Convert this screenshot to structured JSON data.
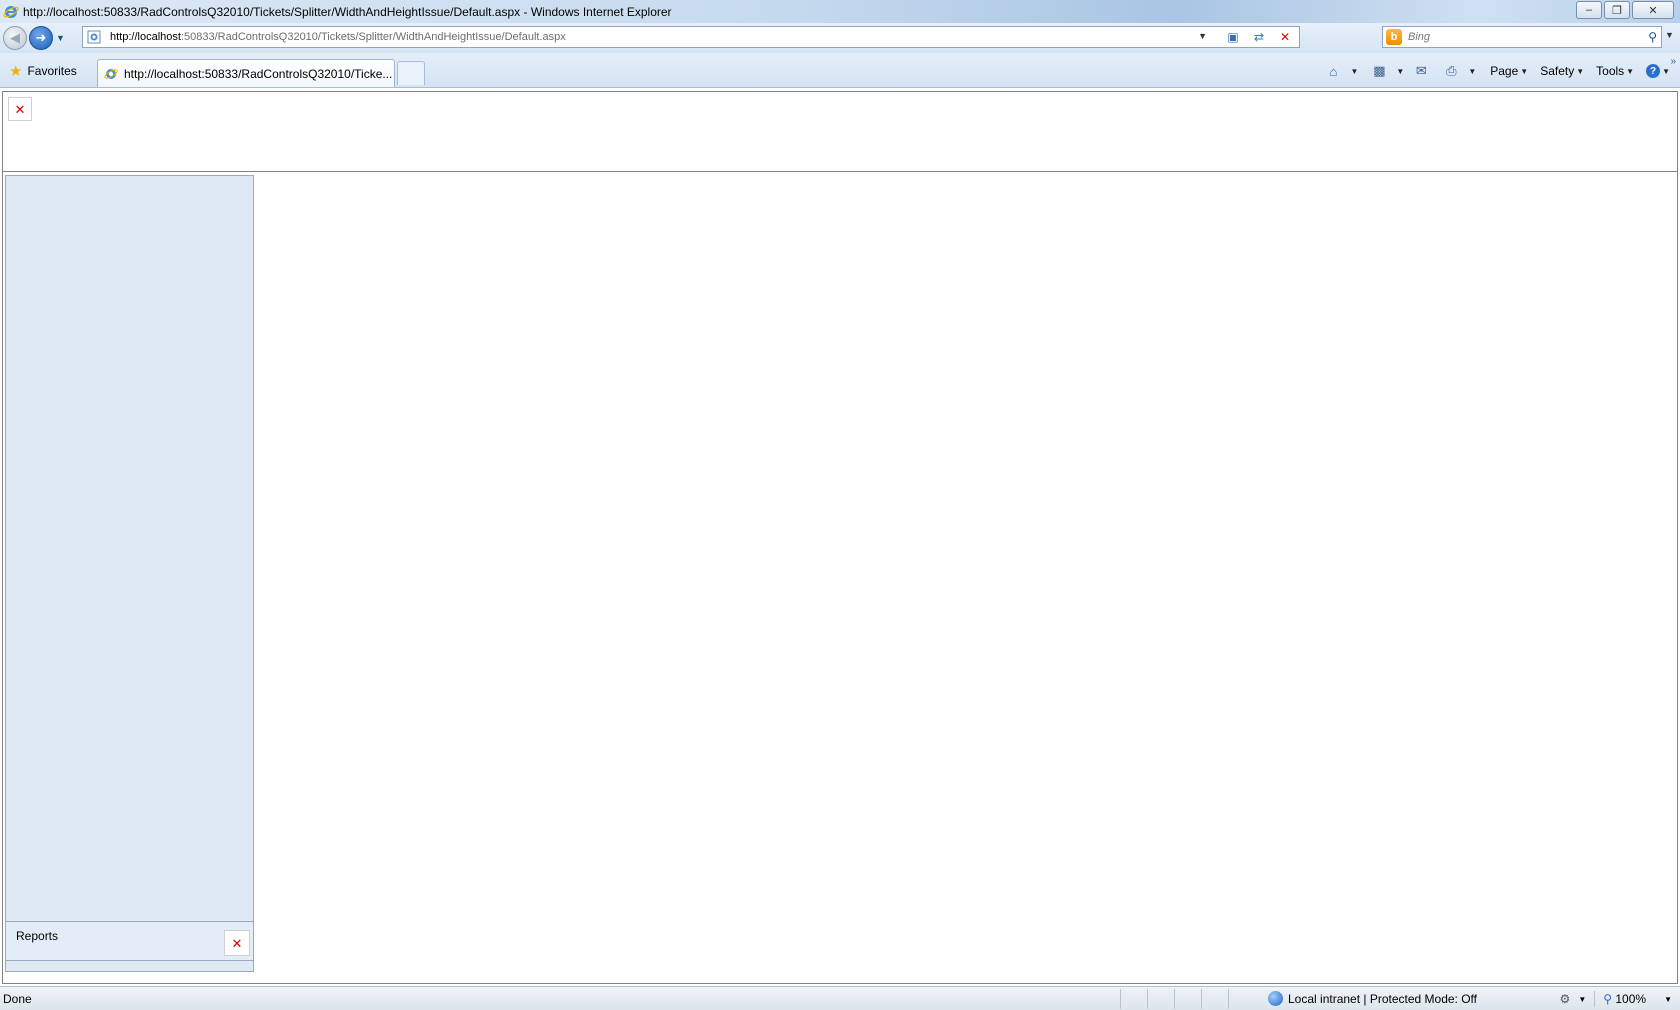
{
  "window": {
    "title": "http://localhost:50833/RadControlsQ32010/Tickets/Splitter/WidthAndHeightIssue/Default.aspx - Windows Internet Explorer",
    "minimize": "–",
    "restore": "❐",
    "close": "✕"
  },
  "address": {
    "host": "http://localhost",
    "path": ":50833/RadControlsQ32010/Tickets/Splitter/WidthAndHeightIssue/Default.aspx"
  },
  "search": {
    "placeholder": "Bing"
  },
  "favorites": {
    "label": "Favorites"
  },
  "tab": {
    "label": "http://localhost:50833/RadControlsQ32010/Ticke..."
  },
  "toolbar": {
    "page": "Page",
    "safety": "Safety",
    "tools": "Tools"
  },
  "page": {
    "reports_label": "Reports"
  },
  "status": {
    "text": "Done",
    "zone": "Local intranet | Protected Mode: Off",
    "zoom": "100%"
  },
  "icons": {
    "ie": "ie-logo-icon",
    "back": "back-arrow-icon",
    "forward": "forward-arrow-icon",
    "refresh": "refresh-icon",
    "stop": "stop-icon",
    "search": "magnifier-icon",
    "home": "home-icon",
    "feeds": "rss-icon",
    "mail": "mail-icon",
    "print": "printer-icon",
    "help": "help-icon",
    "broken_image": "broken-image-icon"
  },
  "colors": {
    "pane_bg": "#dfe8f5",
    "pane_border": "#99a9bf",
    "broken_x": "#d60000"
  }
}
